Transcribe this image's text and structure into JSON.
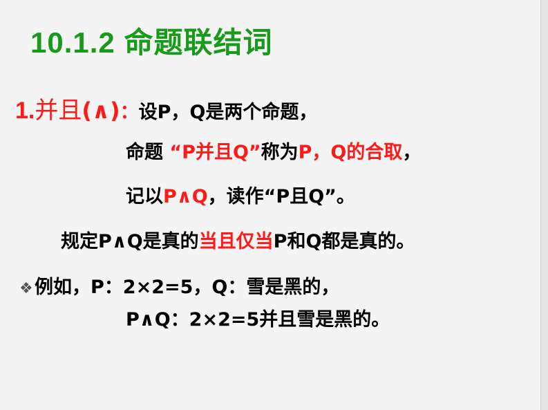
{
  "title": "10.1.2 命题联结词",
  "section": {
    "number": "1.",
    "name": "并且",
    "paren_open": "(",
    "symbol": "∧",
    "paren_close": ")",
    "colon": "：",
    "intro": "设P，Q是两个命题，"
  },
  "line2": {
    "prefix": "命题 ",
    "highlight": "“P并且Q”",
    "mid": "称为",
    "highlight2": "P，Q的合取",
    "suffix": "，"
  },
  "line3": {
    "prefix": "记以",
    "highlight": "P∧Q",
    "suffix": "，读作“P且Q”。"
  },
  "line4": {
    "prefix": "规定P∧Q是真的",
    "highlight": "当且仅当",
    "suffix": "P和Q都是真的。"
  },
  "example": {
    "bullet": "❖",
    "line1": "例如，P：2×2=5，Q：雪是黑的，",
    "line2": "P∧Q：2×2=5并且雪是黑的。"
  },
  "colors": {
    "title": "#1a9a1a",
    "accent": "#ff1a1a",
    "background": "#f4f4f4"
  }
}
